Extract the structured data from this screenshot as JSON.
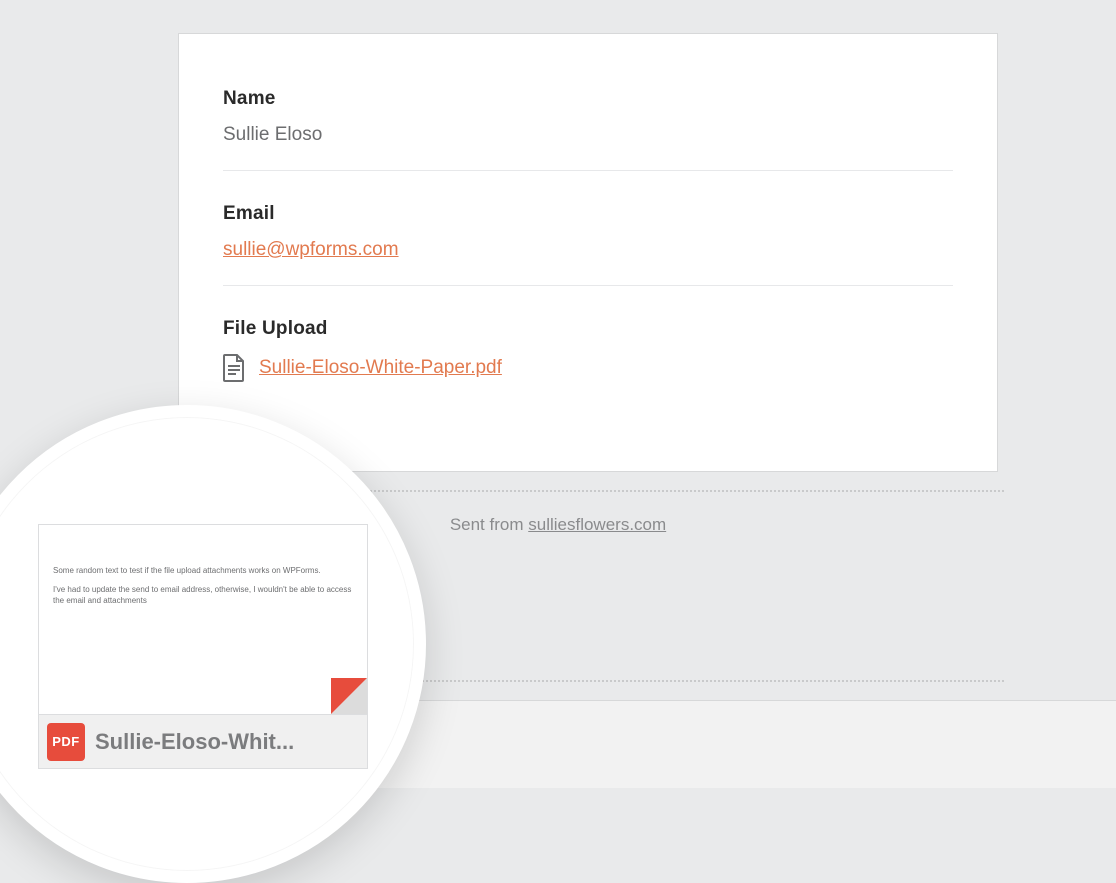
{
  "form": {
    "name_label": "Name",
    "name_value": "Sullie Eloso",
    "email_label": "Email",
    "email_value": "sullie@wpforms.com",
    "file_label": "File Upload",
    "file_link_text": "Sullie-Eloso-White-Paper.pdf"
  },
  "footer": {
    "sent_prefix": "Sent from ",
    "sent_domain": "sulliesflowers.com"
  },
  "attachment": {
    "badge": "PDF",
    "truncated_name": "Sullie-Eloso-Whit...",
    "preview_line1": "Some random text to test if the file upload attachments works on WPForms.",
    "preview_line2": "I've had to update the send to email address, otherwise, I wouldn't be able to access the email and attachments"
  }
}
